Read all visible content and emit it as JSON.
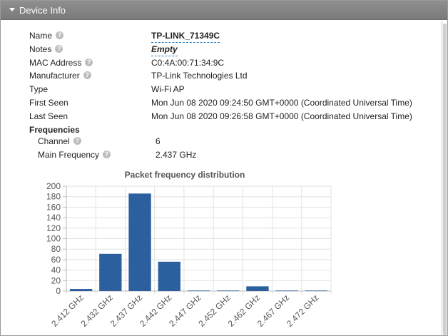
{
  "panel": {
    "title": "Device Info"
  },
  "fields": [
    {
      "label": "Name",
      "value": "TP-LINK_71349C",
      "style": "editable-bold"
    },
    {
      "label": "Notes",
      "value": "Empty",
      "style": "editable-italic"
    },
    {
      "label": "MAC Address",
      "value": "C0:4A:00:71:34:9C"
    },
    {
      "label": "Manufacturer",
      "value": "TP-Link Technologies Ltd"
    },
    {
      "label": "Type",
      "value": "Wi-Fi AP"
    },
    {
      "label": "First Seen",
      "value": "Mon Jun 08 2020 09:24:50 GMT+0000 (Coordinated Universal Time)"
    },
    {
      "label": "Last Seen",
      "value": "Mon Jun 08 2020 09:26:58 GMT+0000 (Coordinated Universal Time)"
    }
  ],
  "frequencies": {
    "title": "Frequencies",
    "channel_label": "Channel",
    "channel_value": "6",
    "main_frequency_label": "Main Frequency",
    "main_frequency_value": "2.437 GHz"
  },
  "help_glyph": "?",
  "chart_data": {
    "type": "bar",
    "title": "Packet frequency distribution",
    "categories": [
      "2.412 GHz",
      "2.432 GHz",
      "2.437 GHz",
      "2.442 GHz",
      "2.447 GHz",
      "2.452 GHz",
      "2.462 GHz",
      "2.467 GHz",
      "2.472 GHz"
    ],
    "values": [
      4,
      71,
      186,
      56,
      1,
      1,
      9,
      1,
      1
    ],
    "ylim": [
      0,
      200
    ],
    "yticks": [
      0,
      20,
      40,
      60,
      80,
      100,
      120,
      140,
      160,
      180,
      200
    ],
    "grid": true,
    "bar_color": "#2c5f9e"
  }
}
